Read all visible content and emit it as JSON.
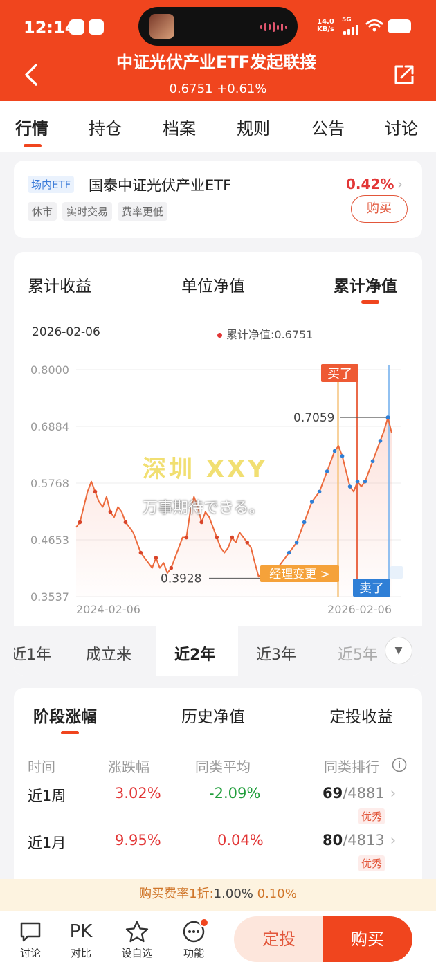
{
  "status_bar": {
    "time": "12:14",
    "speed_top": "14.0",
    "speed_unit": "KB/s",
    "network": "5G"
  },
  "header": {
    "title": "中证光伏产业ETF发起联接",
    "price": "0.6751",
    "change": "+0.61%",
    "icons": [
      "back-icon",
      "share-icon"
    ]
  },
  "tabs": [
    "行情",
    "持仓",
    "档案",
    "规则",
    "公告",
    "讨论"
  ],
  "etf": {
    "tag": "场内ETF",
    "name": "国泰中证光伏产业ETF",
    "change": "0.42%",
    "badges": [
      "休市",
      "实时交易",
      "费率更低"
    ],
    "buy_label": "购买"
  },
  "chart_tabs": [
    "累计收益",
    "单位净值",
    "累计净值"
  ],
  "chart_info": {
    "date": "2026-02-06",
    "legend": "累计净值:0.6751"
  },
  "watermark": {
    "line1": "深圳 XXY",
    "line2": "万事期待できる。"
  },
  "chart_data": {
    "type": "line",
    "x_labels": [
      "2024-02-06",
      "2026-02-06"
    ],
    "y_ticks": [
      "0.8000",
      "0.6884",
      "0.5768",
      "0.4653",
      "0.3537"
    ],
    "ylim": [
      0.3537,
      0.8
    ],
    "series": [
      {
        "values": [
          0.49,
          0.5,
          0.53,
          0.56,
          0.58,
          0.56,
          0.54,
          0.53,
          0.55,
          0.52,
          0.51,
          0.53,
          0.52,
          0.5,
          0.49,
          0.48,
          0.46,
          0.44,
          0.43,
          0.42,
          0.41,
          0.43,
          0.41,
          0.42,
          0.4,
          0.41,
          0.43,
          0.45,
          0.47,
          0.47,
          0.52,
          0.55,
          0.53,
          0.5,
          0.52,
          0.51,
          0.49,
          0.47,
          0.45,
          0.44,
          0.45,
          0.47,
          0.46,
          0.48,
          0.47,
          0.46,
          0.45,
          0.42,
          0.3928,
          0.4,
          0.41,
          0.4,
          0.39,
          0.41,
          0.42,
          0.43,
          0.44,
          0.45,
          0.46,
          0.48,
          0.5,
          0.52,
          0.54,
          0.55,
          0.56,
          0.58,
          0.6,
          0.62,
          0.64,
          0.65,
          0.63,
          0.6,
          0.57,
          0.56,
          0.58,
          0.57,
          0.58,
          0.6,
          0.62,
          0.64,
          0.66,
          0.68,
          0.7059,
          0.6751
        ]
      }
    ],
    "annotations": {
      "low": "0.3928",
      "high": "0.7059",
      "buy": "买了",
      "sell": "卖了",
      "manager_change": "经理变更 >"
    }
  },
  "range_tabs": [
    "近1年",
    "成立来",
    "近2年",
    "近3年",
    "近5年"
  ],
  "perf_tabs": [
    "阶段涨幅",
    "历史净值",
    "定投收益"
  ],
  "perf_headers": [
    "时间",
    "涨跌幅",
    "同类平均",
    "同类排行"
  ],
  "perf_rows": [
    {
      "period": "近1周",
      "change": "3.02%",
      "avg": "-2.09%",
      "rank": "69",
      "total": "/4881",
      "tag": "优秀"
    },
    {
      "period": "近1月",
      "change": "9.95%",
      "avg": "0.04%",
      "rank": "80",
      "total": "/4813",
      "tag": "优秀"
    }
  ],
  "fee": {
    "prefix": "购买费率1折:",
    "old": "1.00%",
    "new": "0.10%"
  },
  "bottom_nav": [
    {
      "label": "讨论",
      "icon": "chat-icon"
    },
    {
      "label": "对比",
      "icon": "pk-icon",
      "glyph": "PK"
    },
    {
      "label": "设自选",
      "icon": "star-icon"
    },
    {
      "label": "功能",
      "icon": "more-icon"
    }
  ],
  "actions": {
    "dingtou": "定投",
    "buy": "购买"
  }
}
